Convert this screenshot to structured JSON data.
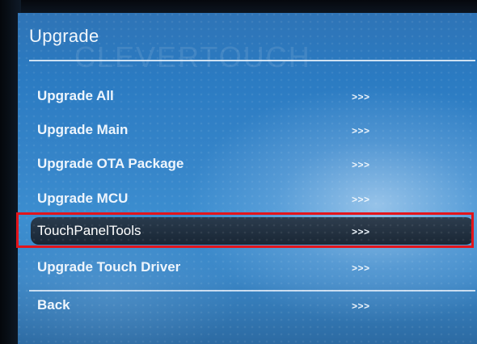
{
  "menu": {
    "title": "Upgrade",
    "watermark": "CLEVERTOUCH",
    "items": [
      {
        "label": "Upgrade All",
        "arrow": ">>>"
      },
      {
        "label": "Upgrade Main",
        "arrow": ">>>"
      },
      {
        "label": "Upgrade OTA Package",
        "arrow": ">>>"
      },
      {
        "label": "Upgrade MCU",
        "arrow": ">>>"
      },
      {
        "label": "TouchPanelTools",
        "arrow": ">>>"
      },
      {
        "label": "Upgrade Touch Driver",
        "arrow": ">>>"
      },
      {
        "label": "Back",
        "arrow": ">>>"
      }
    ],
    "selected_item": "TouchPanelTools"
  },
  "colors": {
    "screen_blue": "#3685c9",
    "selection_bg": "#1c2a3a",
    "highlight_outline": "#e3141b",
    "text": "#eef5fc"
  }
}
